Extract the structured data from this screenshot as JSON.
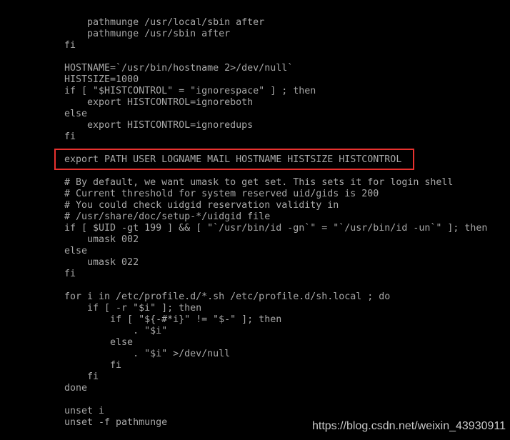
{
  "terminal": {
    "lines": [
      "    pathmunge /usr/local/sbin after",
      "    pathmunge /usr/sbin after",
      "fi",
      "",
      "HOSTNAME=`/usr/bin/hostname 2>/dev/null`",
      "HISTSIZE=1000",
      "if [ \"$HISTCONTROL\" = \"ignorespace\" ] ; then",
      "    export HISTCONTROL=ignoreboth",
      "else",
      "    export HISTCONTROL=ignoredups",
      "fi",
      "",
      "export PATH USER LOGNAME MAIL HOSTNAME HISTSIZE HISTCONTROL",
      "",
      "# By default, we want umask to get set. This sets it for login shell",
      "# Current threshold for system reserved uid/gids is 200",
      "# You could check uidgid reservation validity in",
      "# /usr/share/doc/setup-*/uidgid file",
      "if [ $UID -gt 199 ] && [ \"`/usr/bin/id -gn`\" = \"`/usr/bin/id -un`\" ]; then",
      "    umask 002",
      "else",
      "    umask 022",
      "fi",
      "",
      "for i in /etc/profile.d/*.sh /etc/profile.d/sh.local ; do",
      "    if [ -r \"$i\" ]; then",
      "        if [ \"${-#*i}\" != \"$-\" ]; then",
      "            . \"$i\"",
      "        else",
      "            . \"$i\" >/dev/null",
      "        fi",
      "    fi",
      "done",
      "",
      "unset i",
      "unset -f pathmunge"
    ],
    "highlighted_line": 12,
    "highlight_color": "#e8322f",
    "text_color": "#a8a8a8",
    "background": "#000000"
  },
  "watermark": "https://blog.csdn.net/weixin_43930911"
}
